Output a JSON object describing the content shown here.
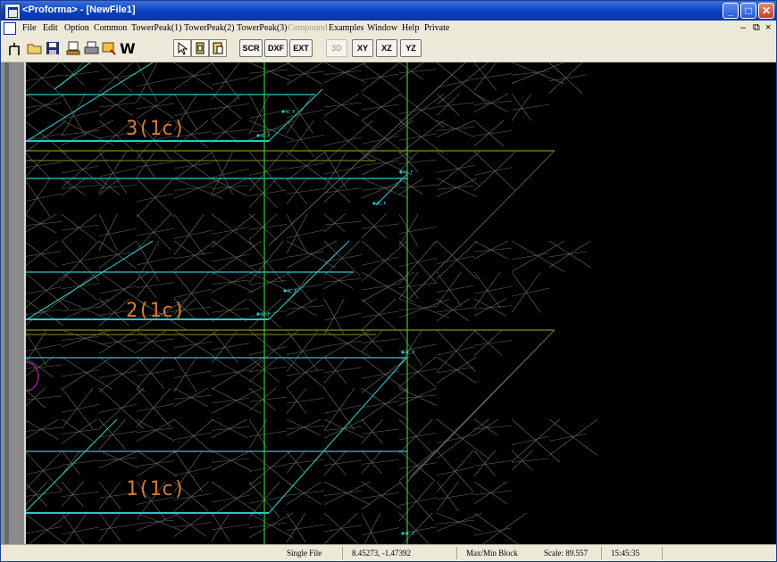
{
  "window": {
    "title": "<Proforma> - [NewFile1]"
  },
  "menu": [
    "File",
    "Edit",
    "Option",
    "Common",
    "TowerPeak(1)",
    "TowerPeak(2)",
    "TowerPeak(3)",
    "Compound",
    "Examples",
    "Window",
    "Help",
    "Private"
  ],
  "menu_disabled": [
    "Compound"
  ],
  "toolbar": {
    "scr_label": "SCR",
    "dxf_label": "DXF",
    "ext_label": "EXT",
    "three_d_label": "3D",
    "xy_label": "XY",
    "xz_label": "XZ",
    "yz_label": "YZ"
  },
  "canvas": {
    "floor_labels": [
      "3(1c)",
      "2(1c)",
      "1(1c)"
    ],
    "node_tag": "4C-F"
  },
  "status": {
    "mode": "Single File",
    "coords": "8.45273, -1.47392",
    "block": "Max/Min Block",
    "scale": "Scale: 89.557",
    "time": "15:45:35"
  },
  "colors": {
    "grid": "#6e7068",
    "beam": "#2cc6c9",
    "axis": "#2fcf2f",
    "label": "#d47a36",
    "floor": "#8a8c2a"
  }
}
